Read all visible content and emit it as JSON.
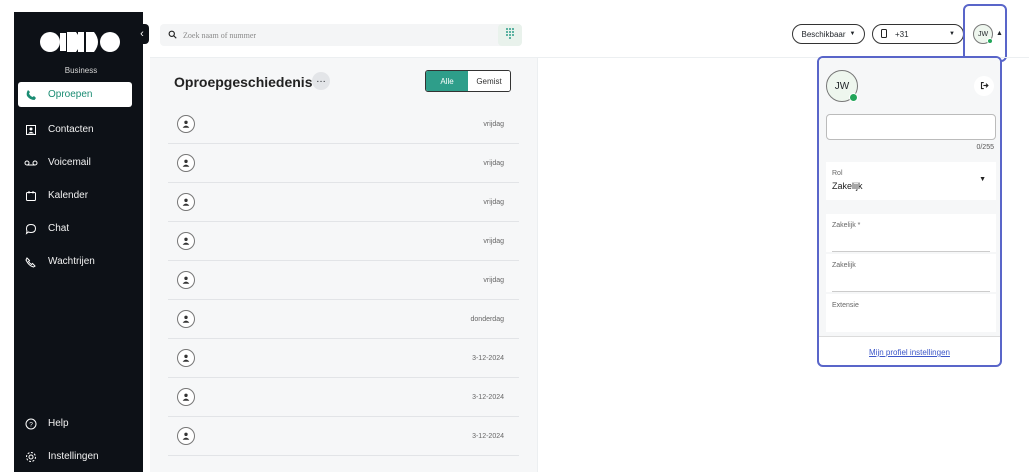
{
  "brand": {
    "logo_text": "ODIDO",
    "sub": "Business"
  },
  "nav": {
    "items": [
      {
        "label": "Oproepen",
        "icon": "phone-icon",
        "active": true
      },
      {
        "label": "Contacten",
        "icon": "contact-card-icon"
      },
      {
        "label": "Voicemail",
        "icon": "voicemail-icon"
      },
      {
        "label": "Kalender",
        "icon": "calendar-icon"
      },
      {
        "label": "Chat",
        "icon": "chat-bubble-icon"
      },
      {
        "label": "Wachtrijen",
        "icon": "queue-icon"
      }
    ],
    "bottom": [
      {
        "label": "Help",
        "icon": "help-icon"
      },
      {
        "label": "Instellingen",
        "icon": "gear-icon"
      }
    ]
  },
  "topbar": {
    "search_placeholder": "Zoek naam of nummer",
    "status_label": "Beschikbaar",
    "phone_prefix": "+31",
    "avatar_initials": "JW"
  },
  "calls": {
    "title": "Oproepgeschiedenis",
    "more": "…",
    "filter_all": "Alle",
    "filter_missed": "Gemist",
    "rows": [
      {
        "date": "vrijdag"
      },
      {
        "date": "vrijdag"
      },
      {
        "date": "vrijdag"
      },
      {
        "date": "vrijdag"
      },
      {
        "date": "vrijdag"
      },
      {
        "date": "donderdag"
      },
      {
        "date": "3-12-2024"
      },
      {
        "date": "3-12-2024"
      },
      {
        "date": "3-12-2024"
      }
    ]
  },
  "profile": {
    "initials": "JW",
    "counter": "0/255",
    "role_label": "Rol",
    "role_value": "Zakelijk",
    "field1_label": "Zakelijk *",
    "field2_label": "Zakelijk",
    "field3_label": "Extensie",
    "settings_link": "Mijn profiel instellingen"
  },
  "colors": {
    "accent": "#2e9e8a",
    "sidebar": "#0d1117",
    "highlight": "#5965c9",
    "online": "#22a559"
  }
}
